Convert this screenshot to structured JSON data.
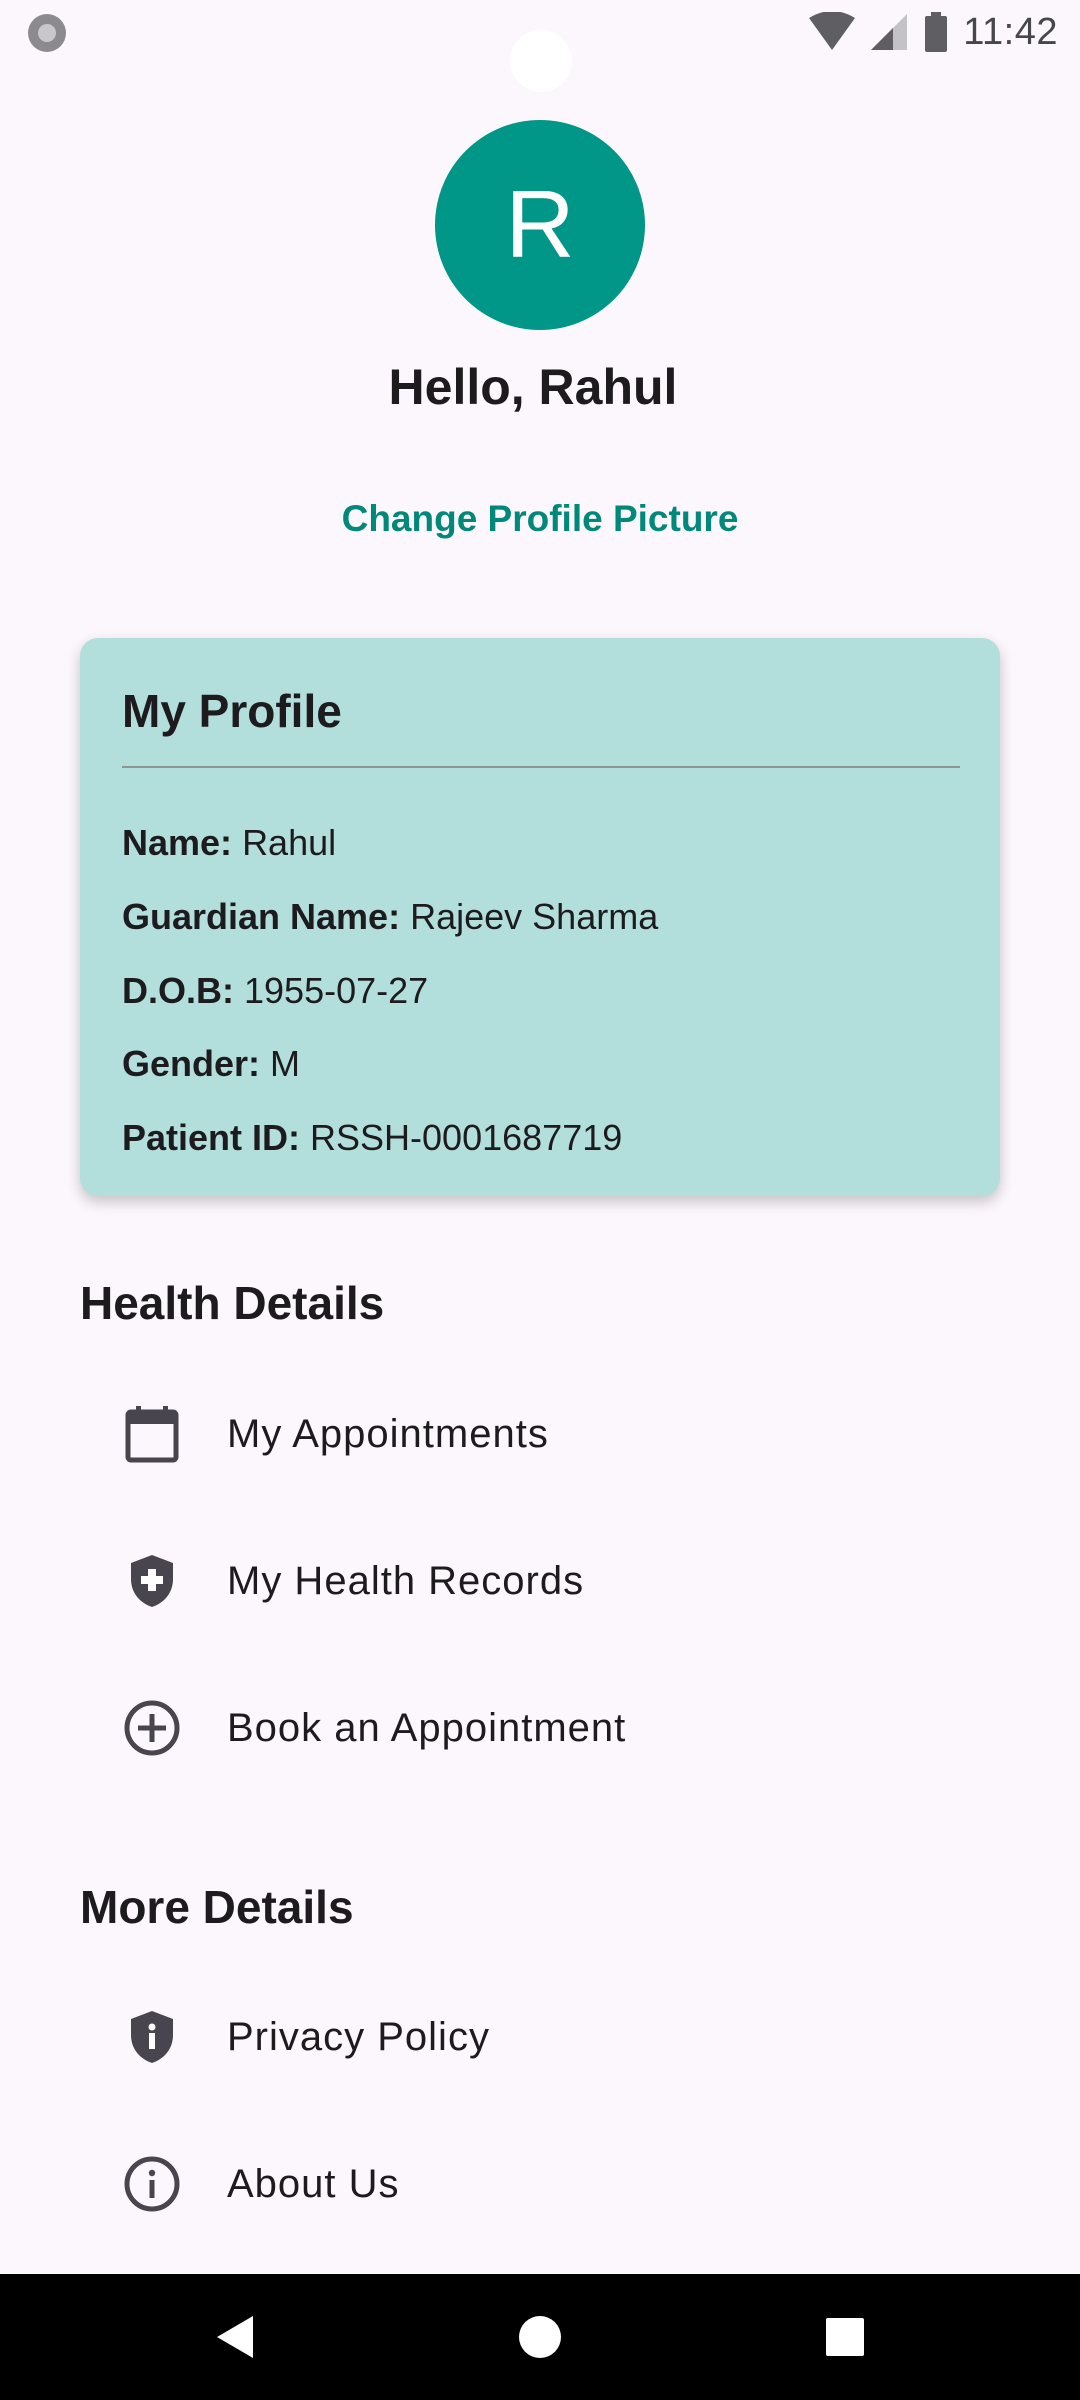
{
  "status_bar": {
    "time": "11:42",
    "icons": [
      "wifi-icon",
      "signal-icon",
      "battery-icon"
    ]
  },
  "header": {
    "avatar_initial": "R",
    "greeting": "Hello, Rahul",
    "change_picture_label": "Change Profile Picture"
  },
  "profile": {
    "title": "My Profile",
    "fields": [
      {
        "label": "Name:",
        "value": "Rahul"
      },
      {
        "label": "Guardian Name:",
        "value": "Rajeev Sharma"
      },
      {
        "label": "D.O.B:",
        "value": "1955-07-27"
      },
      {
        "label": "Gender:",
        "value": "M"
      },
      {
        "label": "Patient ID:",
        "value": "RSSH-0001687719"
      }
    ]
  },
  "health_details": {
    "title": "Health Details",
    "items": [
      {
        "label": "My Appointments",
        "icon": "calendar-icon"
      },
      {
        "label": "My Health Records",
        "icon": "medical-shield-icon"
      },
      {
        "label": "Book an Appointment",
        "icon": "add-circle-icon"
      }
    ]
  },
  "more_details": {
    "title": "More Details",
    "items": [
      {
        "label": "Privacy Policy",
        "icon": "privacy-shield-icon"
      },
      {
        "label": "About Us",
        "icon": "info-icon"
      }
    ]
  },
  "colors": {
    "accent": "#009688",
    "link": "#00897B",
    "card_bg": "#B2DFDB",
    "page_bg": "#FCF7FC"
  }
}
